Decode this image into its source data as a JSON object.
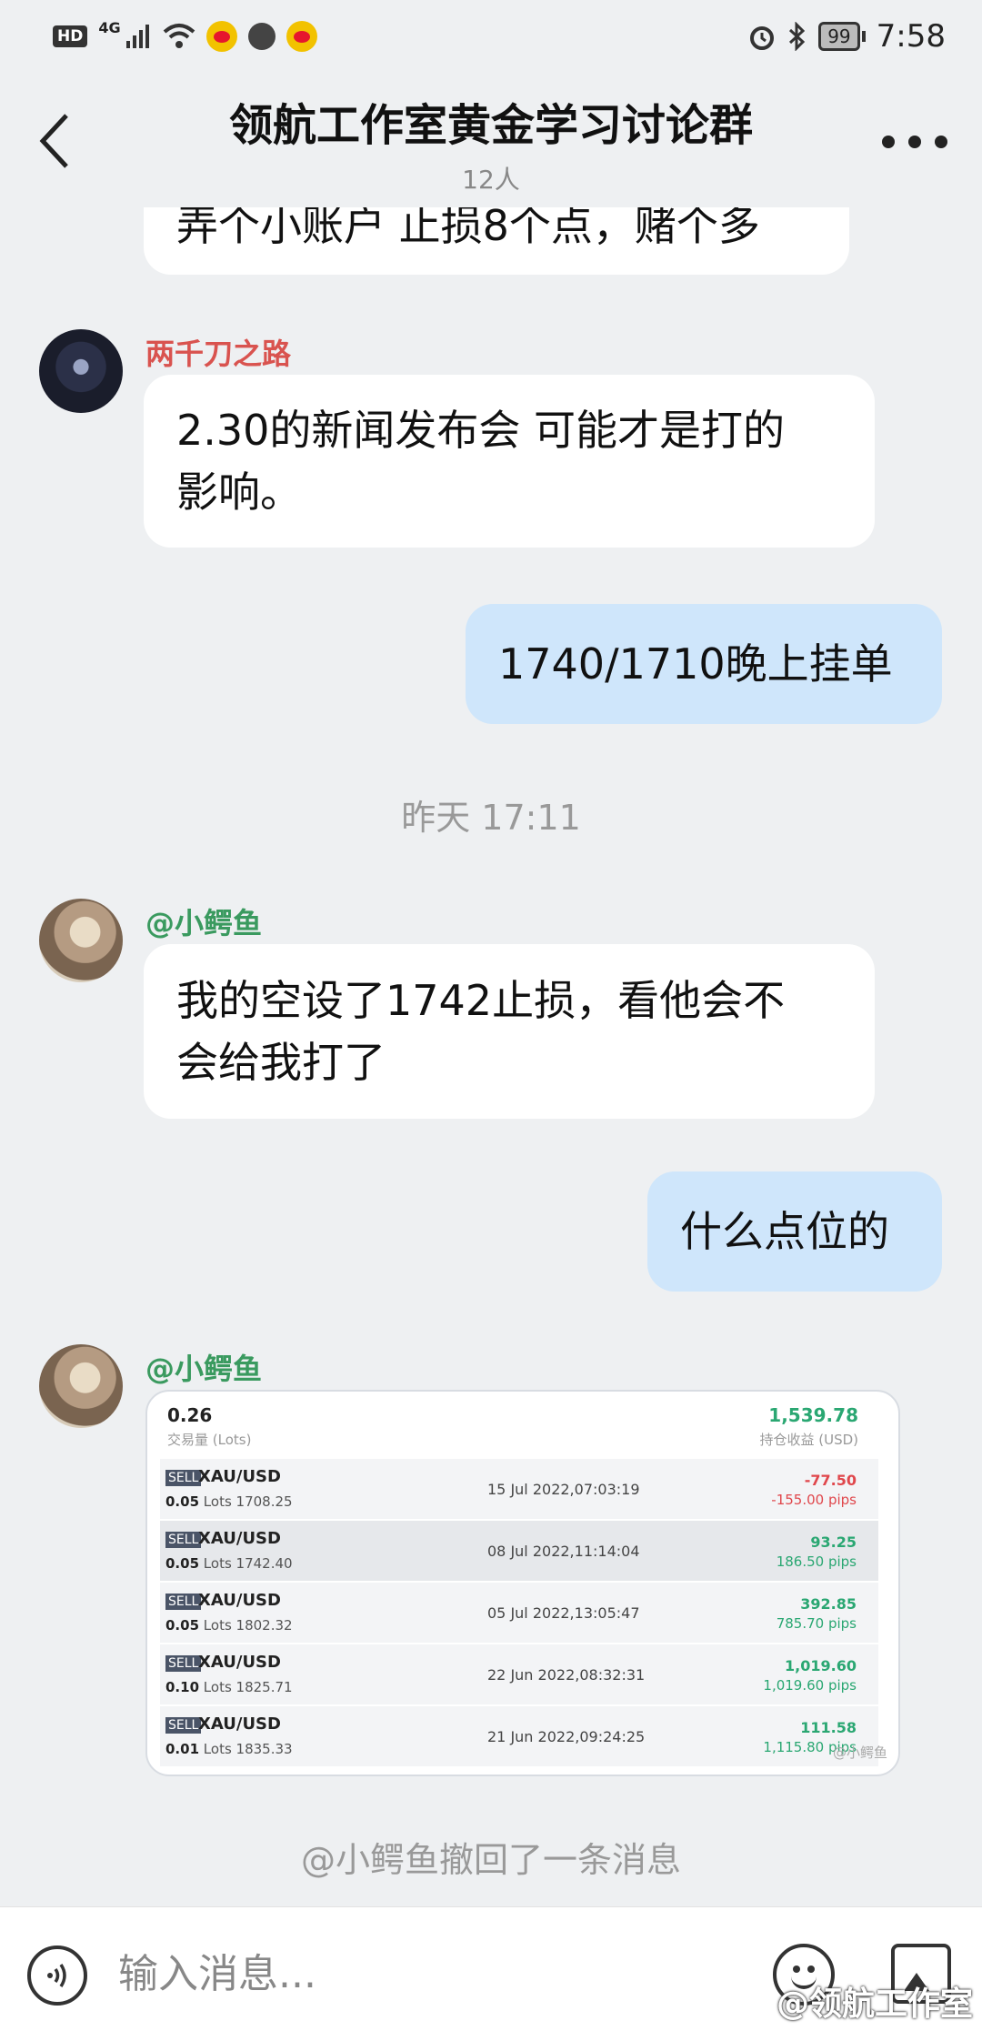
{
  "status_bar": {
    "hd": "HD",
    "network": "4G",
    "battery": "99",
    "time": "7:58"
  },
  "header": {
    "title": "领航工作室黄金学习讨论群",
    "members": "12人"
  },
  "messages": {
    "m0_text": "弄个小账户 止损8个点，赌个多",
    "m1_sender": "两千刀之路",
    "m1_sender_color": "#d9534f",
    "m1_text_line1": "2.30的新闻发布会 可能才是打的",
    "m1_text_line2": "影响。",
    "m2_text": "1740/1710晚上挂单",
    "timestamp": "昨天 17:11",
    "m3_sender": "@小鳄鱼",
    "m3_sender_color": "#3a9a5f",
    "m3_text_line1": "我的空设了1742止损，看他会不",
    "m3_text_line2": "会给我打了",
    "m4_text": "什么点位的",
    "m5_sender": "@小鳄鱼",
    "recall": "@小鳄鱼撤回了一条消息"
  },
  "trade_card": {
    "total_lots": "0.26",
    "total_lots_label": "交易量 (Lots)",
    "total_pnl": "1,539.78",
    "total_pnl_label": "持仓收益 (USD)",
    "rows": [
      {
        "side": "SELL",
        "symbol": "XAU/USD",
        "lots": "0.05",
        "price": "Lots 1708.25",
        "date": "15 Jul 2022,07:03:19",
        "amount": "-77.50",
        "pips": "-155.00 pips",
        "positive": false
      },
      {
        "side": "SELL",
        "symbol": "XAU/USD",
        "lots": "0.05",
        "price": "Lots 1742.40",
        "date": "08 Jul 2022,11:14:04",
        "amount": "93.25",
        "pips": "186.50 pips",
        "positive": true
      },
      {
        "side": "SELL",
        "symbol": "XAU/USD",
        "lots": "0.05",
        "price": "Lots 1802.32",
        "date": "05 Jul 2022,13:05:47",
        "amount": "392.85",
        "pips": "785.70 pips",
        "positive": true
      },
      {
        "side": "SELL",
        "symbol": "XAU/USD",
        "lots": "0.10",
        "price": "Lots 1825.71",
        "date": "22 Jun 2022,08:32:31",
        "amount": "1,019.60",
        "pips": "1,019.60 pips",
        "positive": true
      },
      {
        "side": "SELL",
        "symbol": "XAU/USD",
        "lots": "0.01",
        "price": "Lots 1835.33",
        "date": "21 Jun 2022,09:24:25",
        "amount": "111.58",
        "pips": "1,115.80 pips",
        "positive": true
      }
    ],
    "watermark": "@小鳄鱼"
  },
  "input_bar": {
    "placeholder": "输入消息...",
    "watermark": "@领航工作室"
  }
}
